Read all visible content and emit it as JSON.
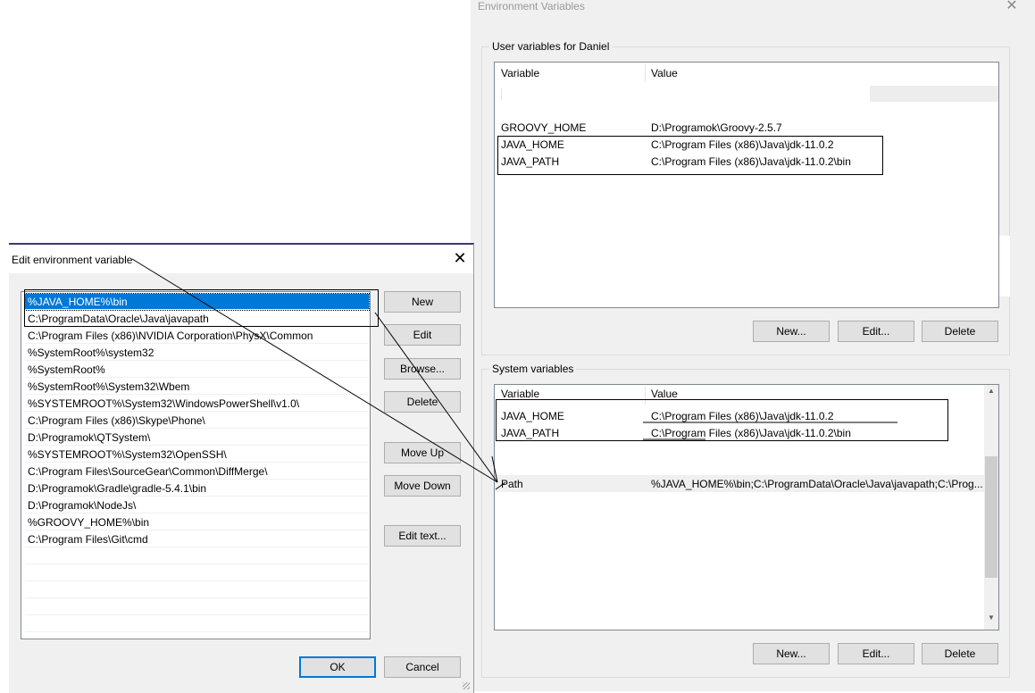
{
  "env_window": {
    "title": "Environment Variables",
    "close_glyph": "✕",
    "user_group": {
      "legend": "User variables for Daniel",
      "columns": [
        "Variable",
        "Value"
      ],
      "rows": [
        {
          "variable": "GROOVY_HOME",
          "value": "D:\\Programok\\Groovy-2.5.7"
        },
        {
          "variable": "JAVA_HOME",
          "value": "C:\\Program Files (x86)\\Java\\jdk-11.0.2"
        },
        {
          "variable": "JAVA_PATH",
          "value": "C:\\Program Files (x86)\\Java\\jdk-11.0.2\\bin"
        }
      ],
      "buttons": {
        "new": "New...",
        "edit": "Edit...",
        "delete": "Delete"
      }
    },
    "system_group": {
      "legend": "System variables",
      "columns": [
        "Variable",
        "Value"
      ],
      "rows": [
        {
          "variable": "JAVA_HOME",
          "value": "C:\\Program Files (x86)\\Java\\jdk-11.0.2"
        },
        {
          "variable": "JAVA_PATH",
          "value": "C:\\Program Files (x86)\\Java\\jdk-11.0.2\\bin"
        },
        {
          "variable": "Path",
          "value": "%JAVA_HOME%\\bin;C:\\ProgramData\\Oracle\\Java\\javapath;C:\\Prog..."
        }
      ],
      "scroll_up": "▲",
      "scroll_down": "▼",
      "buttons": {
        "new": "New...",
        "edit": "Edit...",
        "delete": "Delete"
      }
    }
  },
  "edit_dialog": {
    "title": "Edit environment variable",
    "close_glyph": "✕",
    "path_entries": [
      "%JAVA_HOME%\\bin",
      "C:\\ProgramData\\Oracle\\Java\\javapath",
      "C:\\Program Files (x86)\\NVIDIA Corporation\\PhysX\\Common",
      "%SystemRoot%\\system32",
      "%SystemRoot%",
      "%SystemRoot%\\System32\\Wbem",
      "%SYSTEMROOT%\\System32\\WindowsPowerShell\\v1.0\\",
      "C:\\Program Files (x86)\\Skype\\Phone\\",
      "D:\\Programok\\QTSystem\\",
      "%SYSTEMROOT%\\System32\\OpenSSH\\",
      "C:\\Program Files\\SourceGear\\Common\\DiffMerge\\",
      "D:\\Programok\\Gradle\\gradle-5.4.1\\bin",
      "D:\\Programok\\NodeJs\\",
      "%GROOVY_HOME%\\bin",
      "C:\\Program Files\\Git\\cmd"
    ],
    "selected_index": 0,
    "buttons": {
      "new": "New",
      "edit": "Edit",
      "browse": "Browse...",
      "delete": "Delete",
      "move_up": "Move Up",
      "move_down": "Move Down",
      "edit_text": "Edit text...",
      "ok": "OK",
      "cancel": "Cancel"
    }
  }
}
